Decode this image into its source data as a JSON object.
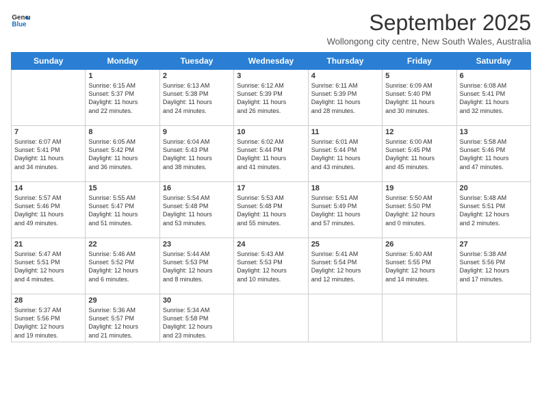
{
  "header": {
    "logo_line1": "General",
    "logo_line2": "Blue",
    "title": "September 2025",
    "subtitle": "Wollongong city centre, New South Wales, Australia"
  },
  "days_of_week": [
    "Sunday",
    "Monday",
    "Tuesday",
    "Wednesday",
    "Thursday",
    "Friday",
    "Saturday"
  ],
  "weeks": [
    [
      {
        "day": "",
        "content": ""
      },
      {
        "day": "1",
        "content": "Sunrise: 6:15 AM\nSunset: 5:37 PM\nDaylight: 11 hours\nand 22 minutes."
      },
      {
        "day": "2",
        "content": "Sunrise: 6:13 AM\nSunset: 5:38 PM\nDaylight: 11 hours\nand 24 minutes."
      },
      {
        "day": "3",
        "content": "Sunrise: 6:12 AM\nSunset: 5:39 PM\nDaylight: 11 hours\nand 26 minutes."
      },
      {
        "day": "4",
        "content": "Sunrise: 6:11 AM\nSunset: 5:39 PM\nDaylight: 11 hours\nand 28 minutes."
      },
      {
        "day": "5",
        "content": "Sunrise: 6:09 AM\nSunset: 5:40 PM\nDaylight: 11 hours\nand 30 minutes."
      },
      {
        "day": "6",
        "content": "Sunrise: 6:08 AM\nSunset: 5:41 PM\nDaylight: 11 hours\nand 32 minutes."
      }
    ],
    [
      {
        "day": "7",
        "content": "Sunrise: 6:07 AM\nSunset: 5:41 PM\nDaylight: 11 hours\nand 34 minutes."
      },
      {
        "day": "8",
        "content": "Sunrise: 6:05 AM\nSunset: 5:42 PM\nDaylight: 11 hours\nand 36 minutes."
      },
      {
        "day": "9",
        "content": "Sunrise: 6:04 AM\nSunset: 5:43 PM\nDaylight: 11 hours\nand 38 minutes."
      },
      {
        "day": "10",
        "content": "Sunrise: 6:02 AM\nSunset: 5:44 PM\nDaylight: 11 hours\nand 41 minutes."
      },
      {
        "day": "11",
        "content": "Sunrise: 6:01 AM\nSunset: 5:44 PM\nDaylight: 11 hours\nand 43 minutes."
      },
      {
        "day": "12",
        "content": "Sunrise: 6:00 AM\nSunset: 5:45 PM\nDaylight: 11 hours\nand 45 minutes."
      },
      {
        "day": "13",
        "content": "Sunrise: 5:58 AM\nSunset: 5:46 PM\nDaylight: 11 hours\nand 47 minutes."
      }
    ],
    [
      {
        "day": "14",
        "content": "Sunrise: 5:57 AM\nSunset: 5:46 PM\nDaylight: 11 hours\nand 49 minutes."
      },
      {
        "day": "15",
        "content": "Sunrise: 5:55 AM\nSunset: 5:47 PM\nDaylight: 11 hours\nand 51 minutes."
      },
      {
        "day": "16",
        "content": "Sunrise: 5:54 AM\nSunset: 5:48 PM\nDaylight: 11 hours\nand 53 minutes."
      },
      {
        "day": "17",
        "content": "Sunrise: 5:53 AM\nSunset: 5:48 PM\nDaylight: 11 hours\nand 55 minutes."
      },
      {
        "day": "18",
        "content": "Sunrise: 5:51 AM\nSunset: 5:49 PM\nDaylight: 11 hours\nand 57 minutes."
      },
      {
        "day": "19",
        "content": "Sunrise: 5:50 AM\nSunset: 5:50 PM\nDaylight: 12 hours\nand 0 minutes."
      },
      {
        "day": "20",
        "content": "Sunrise: 5:48 AM\nSunset: 5:51 PM\nDaylight: 12 hours\nand 2 minutes."
      }
    ],
    [
      {
        "day": "21",
        "content": "Sunrise: 5:47 AM\nSunset: 5:51 PM\nDaylight: 12 hours\nand 4 minutes."
      },
      {
        "day": "22",
        "content": "Sunrise: 5:46 AM\nSunset: 5:52 PM\nDaylight: 12 hours\nand 6 minutes."
      },
      {
        "day": "23",
        "content": "Sunrise: 5:44 AM\nSunset: 5:53 PM\nDaylight: 12 hours\nand 8 minutes."
      },
      {
        "day": "24",
        "content": "Sunrise: 5:43 AM\nSunset: 5:53 PM\nDaylight: 12 hours\nand 10 minutes."
      },
      {
        "day": "25",
        "content": "Sunrise: 5:41 AM\nSunset: 5:54 PM\nDaylight: 12 hours\nand 12 minutes."
      },
      {
        "day": "26",
        "content": "Sunrise: 5:40 AM\nSunset: 5:55 PM\nDaylight: 12 hours\nand 14 minutes."
      },
      {
        "day": "27",
        "content": "Sunrise: 5:38 AM\nSunset: 5:56 PM\nDaylight: 12 hours\nand 17 minutes."
      }
    ],
    [
      {
        "day": "28",
        "content": "Sunrise: 5:37 AM\nSunset: 5:56 PM\nDaylight: 12 hours\nand 19 minutes."
      },
      {
        "day": "29",
        "content": "Sunrise: 5:36 AM\nSunset: 5:57 PM\nDaylight: 12 hours\nand 21 minutes."
      },
      {
        "day": "30",
        "content": "Sunrise: 5:34 AM\nSunset: 5:58 PM\nDaylight: 12 hours\nand 23 minutes."
      },
      {
        "day": "",
        "content": ""
      },
      {
        "day": "",
        "content": ""
      },
      {
        "day": "",
        "content": ""
      },
      {
        "day": "",
        "content": ""
      }
    ]
  ]
}
